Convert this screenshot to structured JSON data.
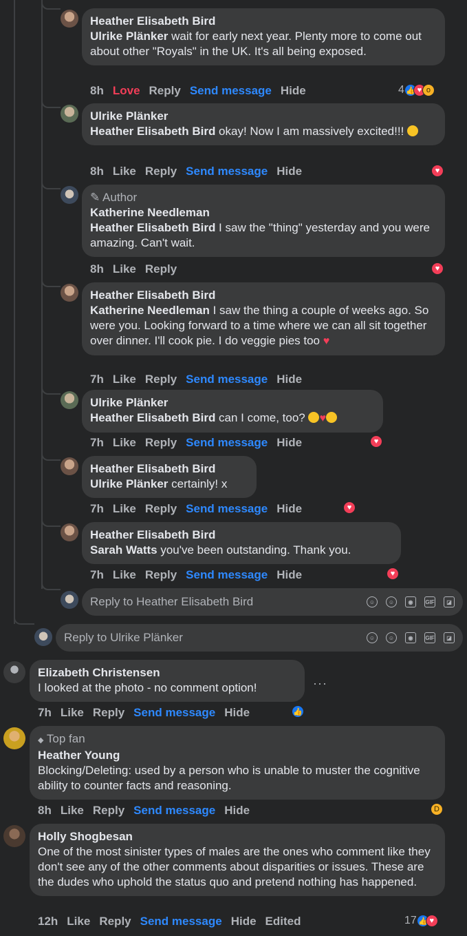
{
  "comments": [
    {
      "author": "Heather Elisabeth Bird",
      "mention": "Ulrike Plänker",
      "text": " wait for early next year. Plenty more to come out about other \"Royals\" in the UK. It's all being exposed.",
      "time": "8h",
      "like": "Love",
      "reply": "Reply",
      "send": "Send message",
      "hide": "Hide",
      "reactions": "4"
    },
    {
      "author": "Ulrike Plänker",
      "mention": "Heather Elisabeth Bird",
      "text": " okay! Now I am massively excited!!! ",
      "time": "8h",
      "like": "Like",
      "reply": "Reply",
      "send": "Send message",
      "hide": "Hide"
    },
    {
      "badge": "Author",
      "author": "Katherine Needleman",
      "mention": "Heather Elisabeth Bird",
      "text": " I saw the \"thing\" yesterday and you were amazing. Can't wait.",
      "time": "8h",
      "like": "Like",
      "reply": "Reply"
    },
    {
      "author": "Heather Elisabeth Bird",
      "mention": "Katherine Needleman",
      "text": " I saw the thing a couple of weeks ago. So were you. Looking forward to a time where we can all sit together over dinner. I'll cook pie. I do veggie pies too ",
      "time": "7h",
      "like": "Like",
      "reply": "Reply",
      "send": "Send message",
      "hide": "Hide"
    },
    {
      "author": "Ulrike Plänker",
      "mention": "Heather Elisabeth Bird",
      "text": " can I come, too? ",
      "time": "7h",
      "like": "Like",
      "reply": "Reply",
      "send": "Send message",
      "hide": "Hide"
    },
    {
      "author": "Heather Elisabeth Bird",
      "mention": "Ulrike Plänker",
      "text": " certainly! x",
      "time": "7h",
      "like": "Like",
      "reply": "Reply",
      "send": "Send message",
      "hide": "Hide"
    },
    {
      "author": "Heather Elisabeth Bird",
      "mention": "Sarah Watts",
      "text": " you've been outstanding. Thank you.",
      "time": "7h",
      "like": "Like",
      "reply": "Reply",
      "send": "Send message",
      "hide": "Hide"
    },
    {
      "author": "Elizabeth Christensen",
      "text": "I looked at the photo - no comment option!",
      "time": "7h",
      "like": "Like",
      "reply": "Reply",
      "send": "Send message",
      "hide": "Hide"
    },
    {
      "badge": "Top fan",
      "author": "Heather Young",
      "text": "Blocking/Deleting: used by a person who is unable to muster the cognitive ability to counter facts and reasoning.",
      "time": "8h",
      "like": "Like",
      "reply": "Reply",
      "send": "Send message",
      "hide": "Hide"
    },
    {
      "author": "Holly Shogbesan",
      "text": "One of the most sinister types of males are the ones who comment like they don't see any of the other comments about disparities or issues. These are the dudes who uphold the status quo and pretend nothing has happened.",
      "time": "12h",
      "like": "Like",
      "reply": "Reply",
      "send": "Send message",
      "hide": "Hide",
      "edited": "Edited",
      "reactions": "17"
    }
  ],
  "reply_inputs": {
    "inner": "Reply to Heather Elisabeth Bird",
    "outer": "Reply to Ulrike Plänker"
  },
  "icons": {
    "pencil": "✎",
    "diamond": "◆",
    "more": "···"
  },
  "colors": {
    "background": "#242526",
    "bubble": "#3a3b3c",
    "link": "#2e89ff",
    "love": "#f33e58",
    "like": "#1877f2"
  }
}
